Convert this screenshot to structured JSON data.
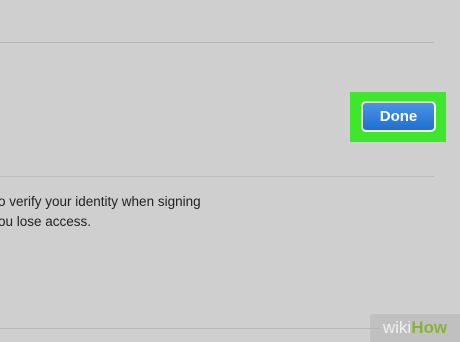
{
  "dialog": {
    "done_label": "Done",
    "description_line1": "o verify your identity when signing",
    "description_line2": "ou lose access."
  },
  "watermark": {
    "part1": "wiki",
    "part2": "How"
  },
  "colors": {
    "background": "#cfcfcf",
    "highlight": "#3ee72c",
    "button_blue": "#1f6fd0",
    "watermark_green": "#86b33d"
  }
}
